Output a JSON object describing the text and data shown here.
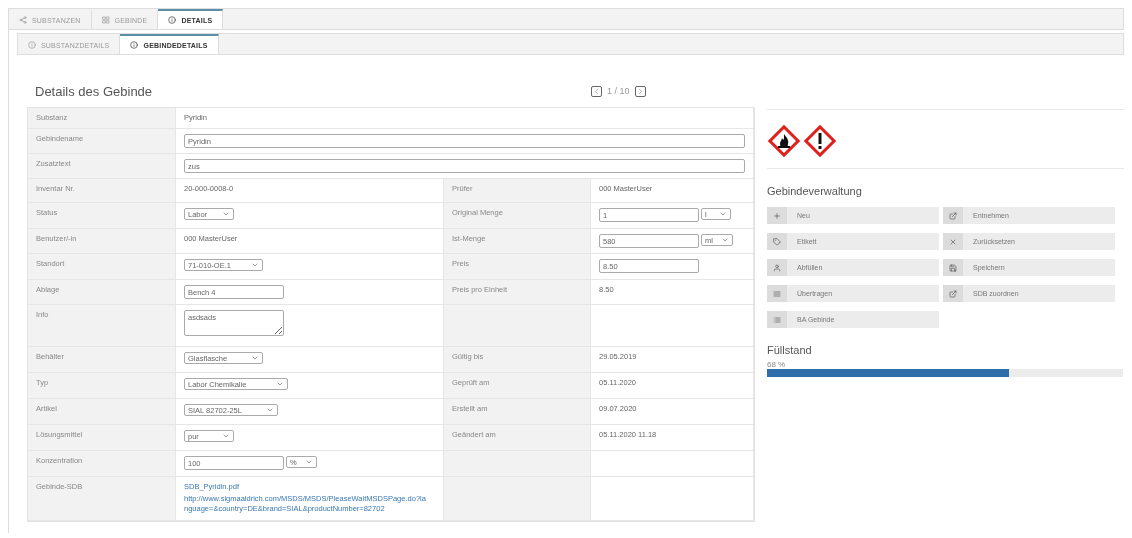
{
  "tabs": [
    {
      "label": "SUBSTANZEN",
      "selected": false
    },
    {
      "label": "GEBINDE",
      "selected": false
    },
    {
      "label": "DETAILS",
      "selected": true
    }
  ],
  "subtabs": [
    {
      "label": "SUBSTANZDETAILS",
      "selected": false
    },
    {
      "label": "GEBINDEDETAILS",
      "selected": true
    }
  ],
  "title": "Details des Gebinde",
  "pager": "1 / 10",
  "rows": [
    {
      "label": "Substanz",
      "kind": "wide",
      "field": {
        "kind": "text",
        "value": "Pyridin"
      }
    },
    {
      "label": "Gebindename",
      "kind": "wide",
      "field": {
        "kind": "input",
        "value": "Pyridin"
      }
    },
    {
      "label": "Zusatztext",
      "kind": "wide",
      "field": {
        "kind": "input",
        "value": "zus"
      }
    },
    {
      "label": "Inventar Nr.",
      "field": {
        "kind": "text",
        "value": "20-000-0008-0"
      },
      "right_label": "Prüfer",
      "right_field": {
        "kind": "text",
        "value": "000 MasterUser"
      }
    },
    {
      "label": "Status",
      "field": {
        "kind": "select",
        "value": "Labor"
      },
      "right_label": "Original Menge",
      "right_field": {
        "kind": "input_select",
        "value": "1",
        "unit": "l"
      }
    },
    {
      "label": "Benutzer/-in",
      "field": {
        "kind": "text",
        "value": "000 MasterUser"
      },
      "right_label": "Ist-Menge",
      "right_field": {
        "kind": "input_select",
        "value": "580",
        "unit": "ml"
      }
    },
    {
      "label": "Standort",
      "field": {
        "kind": "select",
        "value": "71-010-OE.1"
      },
      "right_label": "Preis",
      "right_field": {
        "kind": "input",
        "value": "8.50"
      }
    },
    {
      "label": "Ablage",
      "field": {
        "kind": "input",
        "value": "Bench 4"
      },
      "right_label": "Preis pro Einheit",
      "right_field": {
        "kind": "text",
        "value": "8.50"
      }
    },
    {
      "label": "Info",
      "field": {
        "kind": "textarea",
        "value": "asdsads"
      }
    },
    {
      "label": "Behälter",
      "field": {
        "kind": "select",
        "value": "Glasflasche"
      },
      "right_label": "Gültig bis",
      "right_field": {
        "kind": "text",
        "value": "29.05.2019"
      }
    },
    {
      "label": "Typ",
      "field": {
        "kind": "select",
        "value": "Labor Chemikalie"
      },
      "right_label": "Geprüft am",
      "right_field": {
        "kind": "text",
        "value": "05.11.2020"
      }
    },
    {
      "label": "Artikel",
      "field": {
        "kind": "select",
        "value": "SIAL 82702-25L"
      },
      "right_label": "Erstellt am",
      "right_field": {
        "kind": "text",
        "value": "09.07.2020"
      }
    },
    {
      "label": "Lösungsmittel",
      "field": {
        "kind": "select",
        "value": "pur"
      },
      "right_label": "Geändert am",
      "right_field": {
        "kind": "text",
        "value": "05.11.2020 11.18"
      }
    },
    {
      "label": "Konzentration",
      "field": {
        "kind": "input_select",
        "value": "100",
        "unit": "%"
      }
    },
    {
      "label": "Gebinde-SDB",
      "field": {
        "kind": "links",
        "links": [
          "SDB_Pyridin.pdf",
          "http://www.sigmaaldrich.com/MSDS/MSDS/PleaseWaitMSDSPage.do?language=&country=DE&brand=SIAL&productNumber=82702"
        ]
      }
    }
  ],
  "management": {
    "title": "Gebindeverwaltung",
    "buttons": [
      "Neu",
      "Entnehmen",
      "Etikett",
      "Zurücksetzen",
      "Abfüllen",
      "Speichern",
      "Übertragen",
      "SDB zuordnen",
      "BA Gebinde"
    ]
  },
  "fill": {
    "title": "Füllstand",
    "reading": "68 %",
    "level": 0.68
  }
}
